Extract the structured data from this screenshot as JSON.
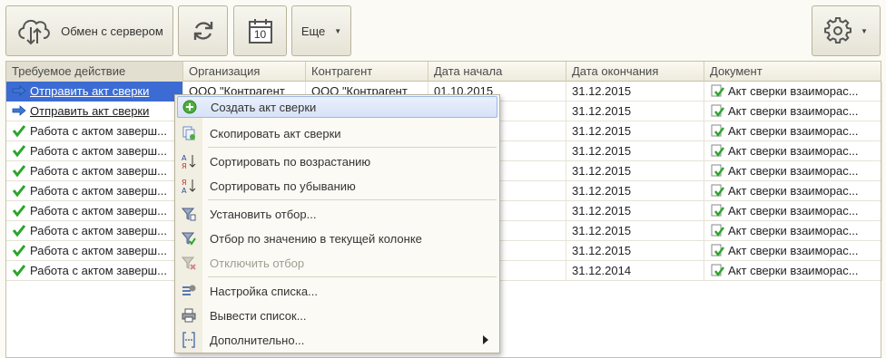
{
  "toolbar": {
    "exchange_label": "Обмен с сервером",
    "more_label": "Еще"
  },
  "icons": {
    "exchange": "cloud-sync-icon",
    "refresh": "refresh-icon",
    "calendar": "calendar-icon",
    "calendar_day": "10",
    "settings": "gear-icon"
  },
  "colors": {
    "selection": "#3c6cd3",
    "highlight_border": "#9db6e4",
    "check": "#2aa52a"
  },
  "table": {
    "columns": [
      "Требуемое действие",
      "Организация",
      "Контрагент",
      "Дата начала",
      "Дата окончания",
      "Документ"
    ],
    "rows": [
      {
        "action": "Отправить акт сверки",
        "org": "ООО \"Контрагент",
        "contr": "ООО \"Контрагент",
        "start": "01.10.2015",
        "end": "31.12.2015",
        "doc": "Акт сверки взаиморас..."
      },
      {
        "action": "Отправить акт сверки",
        "org": "",
        "contr": "",
        "start": "",
        "end": "31.12.2015",
        "doc": "Акт сверки взаиморас..."
      },
      {
        "action": "Работа с актом заверш...",
        "org": "",
        "contr": "",
        "start": "",
        "end": "31.12.2015",
        "doc": "Акт сверки взаиморас..."
      },
      {
        "action": "Работа с актом заверш...",
        "org": "",
        "contr": "",
        "start": "",
        "end": "31.12.2015",
        "doc": "Акт сверки взаиморас..."
      },
      {
        "action": "Работа с актом заверш...",
        "org": "",
        "contr": "",
        "start": "",
        "end": "31.12.2015",
        "doc": "Акт сверки взаиморас..."
      },
      {
        "action": "Работа с актом заверш...",
        "org": "",
        "contr": "",
        "start": "",
        "end": "31.12.2015",
        "doc": "Акт сверки взаиморас..."
      },
      {
        "action": "Работа с актом заверш...",
        "org": "",
        "contr": "",
        "start": "",
        "end": "31.12.2015",
        "doc": "Акт сверки взаиморас..."
      },
      {
        "action": "Работа с актом заверш...",
        "org": "",
        "contr": "",
        "start": "",
        "end": "31.12.2015",
        "doc": "Акт сверки взаиморас..."
      },
      {
        "action": "Работа с актом заверш...",
        "org": "",
        "contr": "",
        "start": "",
        "end": "31.12.2015",
        "doc": "Акт сверки взаиморас..."
      },
      {
        "action": "Работа с актом заверш...",
        "org": "",
        "contr": "",
        "start": "",
        "end": "31.12.2014",
        "doc": "Акт сверки взаиморас..."
      }
    ]
  },
  "context_menu": {
    "items": [
      {
        "label": "Создать акт сверки",
        "icon": "plus-circle-icon"
      },
      {
        "label": "Скопировать акт сверки",
        "icon": "copy-icon"
      },
      {
        "label": "Сортировать по возрастанию",
        "icon": "sort-ascending-icon"
      },
      {
        "label": "Сортировать по убыванию",
        "icon": "sort-descending-icon"
      },
      {
        "label": "Установить отбор...",
        "icon": "filter-settings-icon"
      },
      {
        "label": "Отбор по значению в текущей колонке",
        "icon": "filter-value-icon"
      },
      {
        "label": "Отключить отбор",
        "icon": "filter-off-icon"
      },
      {
        "label": "Настройка списка...",
        "icon": "list-settings-icon"
      },
      {
        "label": "Вывести список...",
        "icon": "print-list-icon"
      },
      {
        "label": "Дополнительно...",
        "icon": "more-brackets-icon"
      }
    ]
  }
}
